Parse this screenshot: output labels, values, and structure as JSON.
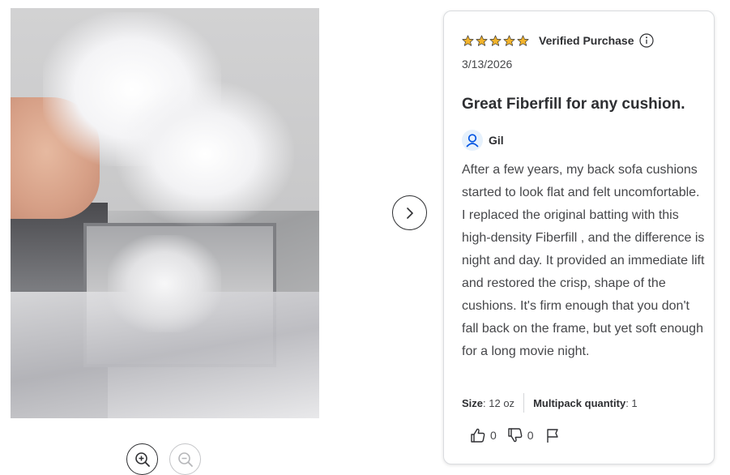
{
  "review": {
    "rating": 5,
    "rating_max": 5,
    "verified_label": "Verified Purchase",
    "date": "3/13/2026",
    "title": "Great Fiberfill for any cushion.",
    "author": "Gil",
    "body": "After a few years, my back sofa cushions started to look flat and felt uncomfortable. I replaced the original batting with this high-density Fiberfill , and the difference is night and day. It provided an immediate lift and restored the crisp, shape of the cushions. It's firm enough that you don't fall back on the frame, but yet soft enough for a long movie night.",
    "attributes": [
      {
        "label": "Size",
        "value": "12 oz"
      },
      {
        "label": "Multipack quantity",
        "value": "1"
      }
    ],
    "helpful_count": "0",
    "unhelpful_count": "0"
  },
  "icons": {
    "star": "star-icon",
    "info": "info-icon",
    "user": "user-icon",
    "next": "chevron-right-icon",
    "zoom_in": "zoom-in-icon",
    "zoom_out": "zoom-out-icon",
    "thumbs_up": "thumbs-up-icon",
    "thumbs_down": "thumbs-down-icon",
    "flag": "flag-icon"
  },
  "colors": {
    "star": "#f2b32c",
    "text": "#2e2f32",
    "avatar_bg": "#e6f1fc",
    "user_icon": "#0053e2"
  }
}
